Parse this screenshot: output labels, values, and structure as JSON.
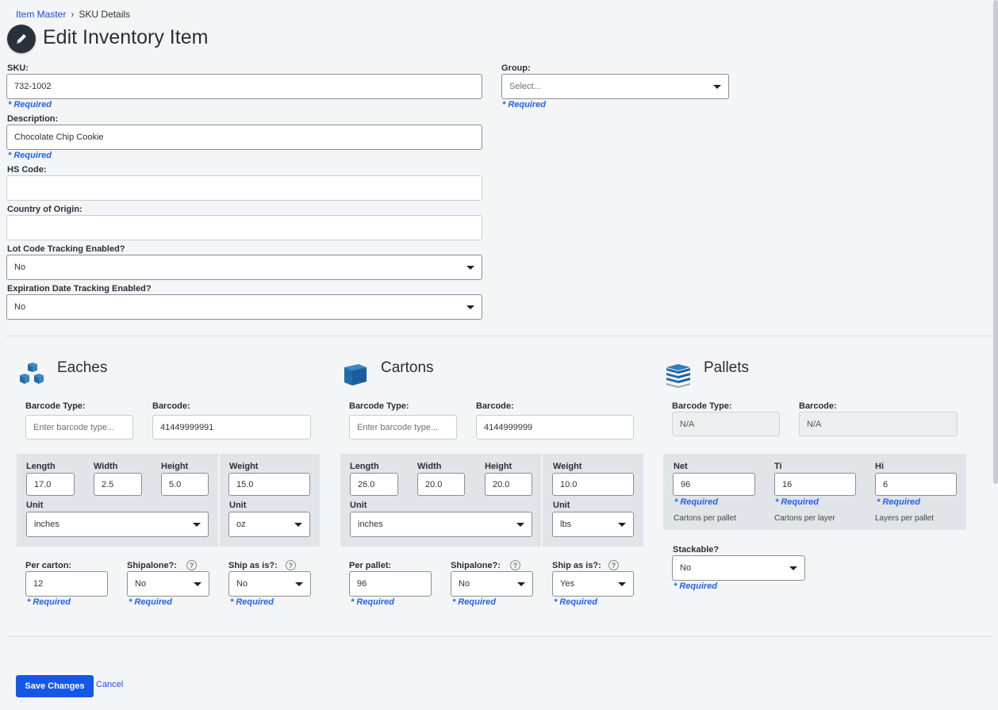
{
  "breadcrumb": {
    "parent": "Item Master",
    "current": "SKU Details"
  },
  "page_title": "Edit Inventory Item",
  "required_text": "* Required",
  "sku": {
    "label": "SKU:",
    "value": "732-1002"
  },
  "group": {
    "label": "Group:",
    "value": "Select..."
  },
  "description": {
    "label": "Description:",
    "value": "Chocolate Chip Cookie"
  },
  "hs_code": {
    "label": "HS Code:",
    "value": ""
  },
  "country": {
    "label": "Country of Origin:",
    "value": ""
  },
  "lot_tracking": {
    "label": "Lot Code Tracking Enabled?",
    "value": "No"
  },
  "exp_tracking": {
    "label": "Expiration Date Tracking Enabled?",
    "value": "No"
  },
  "eaches": {
    "title": "Eaches",
    "barcode_type_label": "Barcode Type:",
    "barcode_type_placeholder": "Enter barcode type...",
    "barcode_label": "Barcode:",
    "barcode": "41449999991",
    "length_label": "Length",
    "length": "17.0",
    "width_label": "Width",
    "width": "2.5",
    "height_label": "Height",
    "height": "5.0",
    "weight_label": "Weight",
    "weight": "15.0",
    "unit_label": "Unit",
    "unit": "inches",
    "weight_unit_label": "Unit",
    "weight_unit": "oz",
    "per_label": "Per carton:",
    "per": "12",
    "shipalone_label": "Shipalone?:",
    "shipalone": "No",
    "shipasis_label": "Ship as is?:",
    "shipasis": "No"
  },
  "cartons": {
    "title": "Cartons",
    "barcode_type_label": "Barcode Type:",
    "barcode_type_placeholder": "Enter barcode type...",
    "barcode_label": "Barcode:",
    "barcode": "4144999999",
    "length_label": "Length",
    "length": "26.0",
    "width_label": "Width",
    "width": "20.0",
    "height_label": "Height",
    "height": "20.0",
    "weight_label": "Weight",
    "weight": "10.0",
    "unit_label": "Unit",
    "unit": "inches",
    "weight_unit_label": "Unit",
    "weight_unit": "lbs",
    "per_label": "Per pallet:",
    "per": "96",
    "shipalone_label": "Shipalone?:",
    "shipalone": "No",
    "shipasis_label": "Ship as is?:",
    "shipasis": "Yes"
  },
  "pallets": {
    "title": "Pallets",
    "barcode_type_label": "Barcode Type:",
    "barcode_type": "N/A",
    "barcode_label": "Barcode:",
    "barcode": "N/A",
    "net_label": "Net",
    "net": "96",
    "net_sub": "Cartons per pallet",
    "ti_label": "Ti",
    "ti": "16",
    "ti_sub": "Cartons per layer",
    "hi_label": "Hi",
    "hi": "6",
    "hi_sub": "Layers per pallet",
    "stackable_label": "Stackable?",
    "stackable": "No"
  },
  "actions": {
    "save": "Save Changes",
    "cancel": "Cancel"
  },
  "help_glyph": "?",
  "colors": {
    "primary": "#1657e8",
    "required": "#2563eb",
    "icon_blue": "#1e6bb0"
  }
}
